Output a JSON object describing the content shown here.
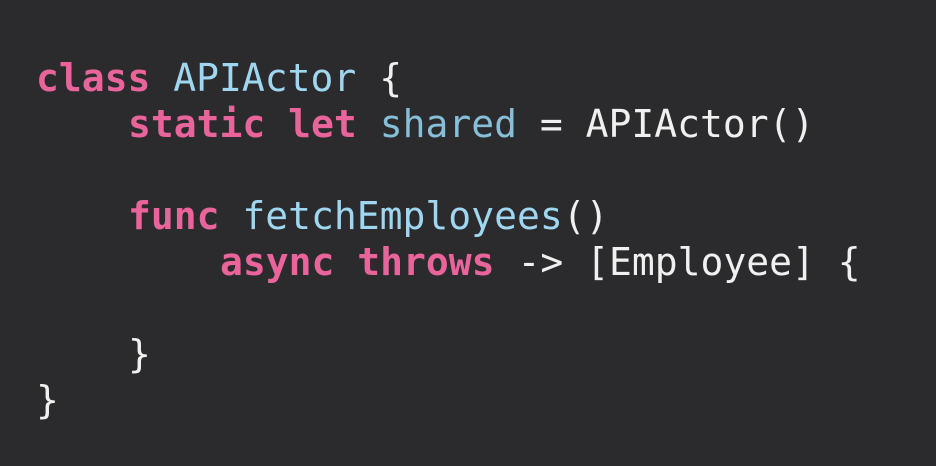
{
  "code": {
    "line1": {
      "kw": "class",
      "name": "APIActor",
      "brace": "{"
    },
    "line2": {
      "kw1": "static",
      "kw2": "let",
      "ident": "shared",
      "op": "=",
      "call": "APIActor()"
    },
    "line4": {
      "kw": "func",
      "fn": "fetchEmployees",
      "parens": "()"
    },
    "line5": {
      "kw1": "async",
      "kw2": "throws",
      "arrow": "->",
      "ret": "[Employee]",
      "brace": "{"
    },
    "line7": {
      "brace": "}"
    },
    "line8": {
      "brace": "}"
    }
  },
  "colors": {
    "background": "#2b2b2d",
    "keyword": "#e8649b",
    "type": "#9fd6f0",
    "identifier": "#87bfd8",
    "plain": "#f0f0f0"
  }
}
